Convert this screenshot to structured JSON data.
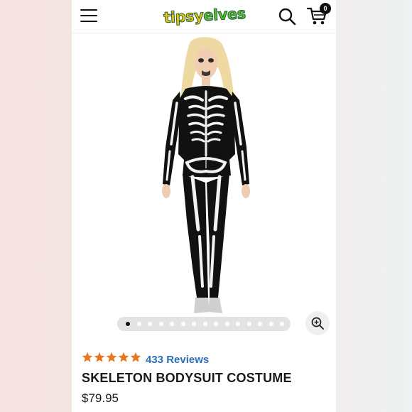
{
  "header": {
    "logo_part1": "tipsy",
    "logo_part2": "elves",
    "cart_count": "0",
    "menu_icon": "hamburger-menu-icon",
    "search_icon": "search-icon",
    "cart_icon": "cart-icon"
  },
  "gallery": {
    "image_alt": "Skeleton bodysuit costume model",
    "dot_count": 15,
    "active_index": 0,
    "zoom_icon": "zoom-in-icon"
  },
  "product": {
    "rating": 5,
    "rating_max": 5,
    "reviews_label": "433 Reviews",
    "title": "SKELETON BODYSUIT COSTUME",
    "price": "$79.95"
  },
  "colors": {
    "star": "#e87722",
    "reviews_link": "#2c6fb8",
    "page_bg": "#ffffff"
  }
}
